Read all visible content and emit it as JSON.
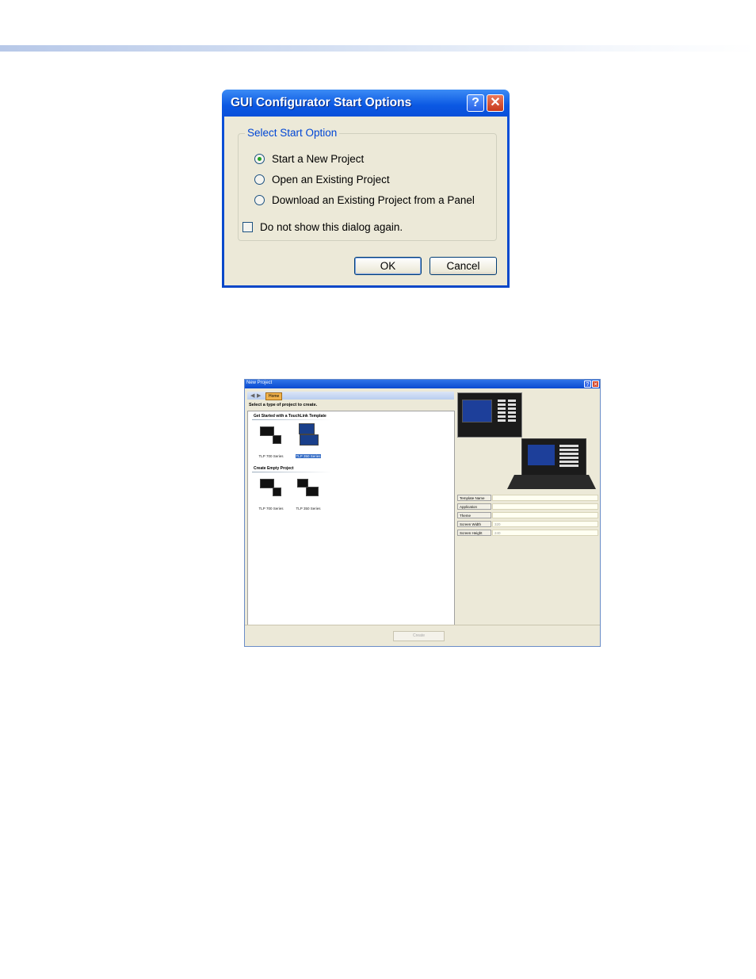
{
  "start_dialog": {
    "title": "GUI Configurator Start Options",
    "help_glyph": "?",
    "close_glyph": "✕",
    "group_label": "Select Start Option",
    "options": [
      {
        "label": "Start a New Project",
        "selected": true
      },
      {
        "label": "Open an Existing Project",
        "selected": false
      },
      {
        "label": "Download an Existing Project from a Panel",
        "selected": false
      }
    ],
    "dont_show_label": "Do not show this dialog again.",
    "dont_show_checked": false,
    "ok_label": "OK",
    "cancel_label": "Cancel"
  },
  "new_project_dialog": {
    "title": "New Project",
    "help_glyph": "?",
    "close_glyph": "✕",
    "back_glyph": "◀",
    "forward_glyph": "▶",
    "home_label": "Home",
    "prompt": "Select a type of project to create.",
    "template_section": "Get Started with a TouchLink Template",
    "template_items": [
      {
        "label": "TLP 700 Series",
        "selected": false
      },
      {
        "label": "TLP 350 Series",
        "selected": true
      }
    ],
    "empty_section": "Create Empty Project",
    "empty_items": [
      {
        "label": "TLP 700 Series"
      },
      {
        "label": "TLP 350 Series"
      }
    ],
    "properties": [
      {
        "key": "Template Name",
        "value": ""
      },
      {
        "key": "Application",
        "value": ""
      },
      {
        "key": "Theme",
        "value": ""
      },
      {
        "key": "Screen Width",
        "value": "320"
      },
      {
        "key": "Screen Height",
        "value": "240"
      }
    ],
    "create_label": "Create"
  }
}
